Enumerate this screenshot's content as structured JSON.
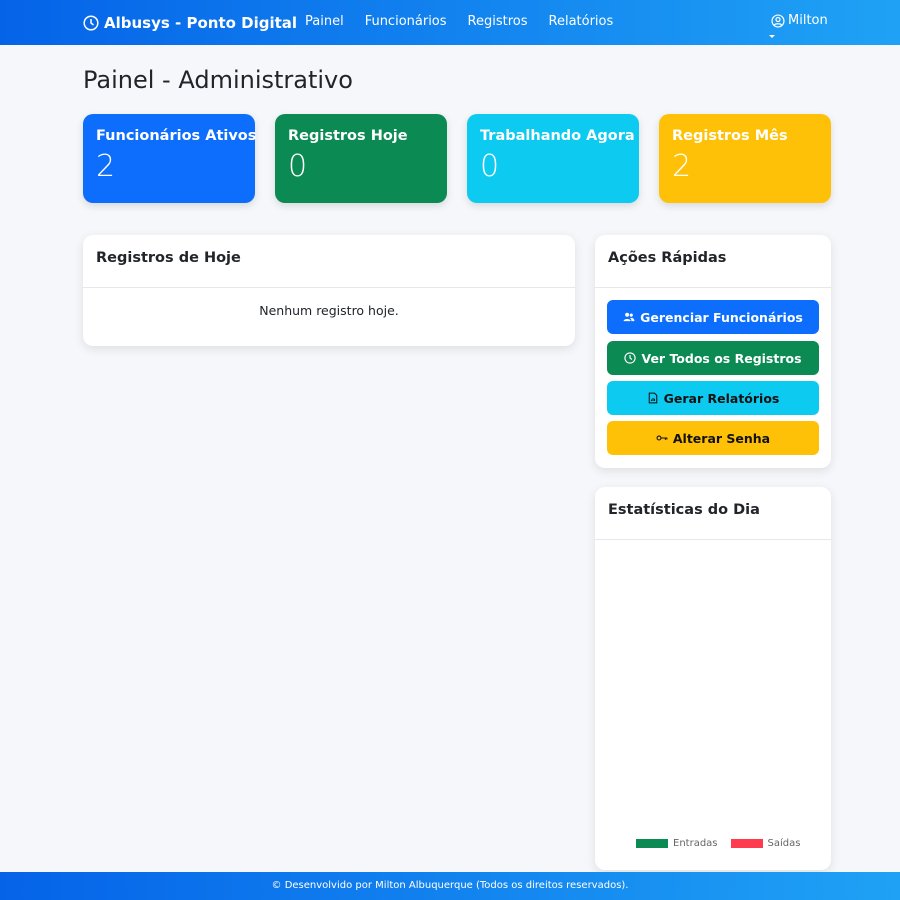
{
  "navbar": {
    "brand": "Albusys - Ponto Digital",
    "brand_icon": "clock-icon",
    "links": [
      "Painel",
      "Funcionários",
      "Registros",
      "Relatórios"
    ],
    "user": "Milton",
    "user_icon": "user-circle-icon"
  },
  "page": {
    "title": "Painel - Administrativo"
  },
  "stats": [
    {
      "label": "Funcionários Ativos",
      "value": "2",
      "color": "#0d6efd"
    },
    {
      "label": "Registros Hoje",
      "value": "0",
      "color": "#0b8a53"
    },
    {
      "label": "Trabalhando Agora",
      "value": "0",
      "color": "#0dcaf0"
    },
    {
      "label": "Registros Mês",
      "value": "2",
      "color": "#ffc107"
    }
  ],
  "today": {
    "title": "Registros de Hoje",
    "empty_message": "Nenhum registro hoje."
  },
  "actions": {
    "title": "Ações Rápidas",
    "buttons": [
      {
        "label": "Gerenciar Funcionários",
        "icon": "users-icon"
      },
      {
        "label": "Ver Todos os Registros",
        "icon": "clock-icon"
      },
      {
        "label": "Gerar Relatórios",
        "icon": "file-chart-icon"
      },
      {
        "label": "Alterar Senha",
        "icon": "key-icon"
      }
    ]
  },
  "day_stats": {
    "title": "Estatísticas do Dia",
    "legend": [
      {
        "label": "Entradas",
        "color": "#0b8a53"
      },
      {
        "label": "Saídas",
        "color": "#ff3b4f"
      }
    ]
  },
  "footer": {
    "text": "© Desenvolvido por Milton Albuquerque (Todos os direitos reservados)."
  }
}
